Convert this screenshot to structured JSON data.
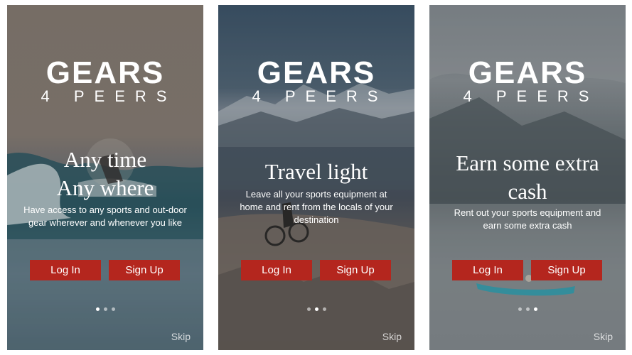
{
  "logo": {
    "title": "GEARS",
    "subtitle": "4 PEERS"
  },
  "screens": [
    {
      "heading_lines": [
        "Any time",
        "Any where"
      ],
      "description": "Have access to any sports and out-door gear wherever and whenever you like",
      "login_label": "Log In",
      "signup_label": "Sign Up",
      "active_dot": 0,
      "skip_label": "Skip"
    },
    {
      "heading_lines": [
        "Travel light"
      ],
      "description": "Leave all your sports equipment at home and rent from the locals of your destination",
      "login_label": "Log In",
      "signup_label": "Sign Up",
      "active_dot": 1,
      "skip_label": "Skip"
    },
    {
      "heading_lines": [
        "Earn some extra",
        "cash"
      ],
      "description": "Rent out your sports equipment and earn some extra cash",
      "login_label": "Log In",
      "signup_label": "Sign Up",
      "active_dot": 2,
      "skip_label": "Skip"
    }
  ],
  "colors": {
    "button": "#b4261e",
    "text": "#ffffff"
  },
  "pagination_count": 3
}
